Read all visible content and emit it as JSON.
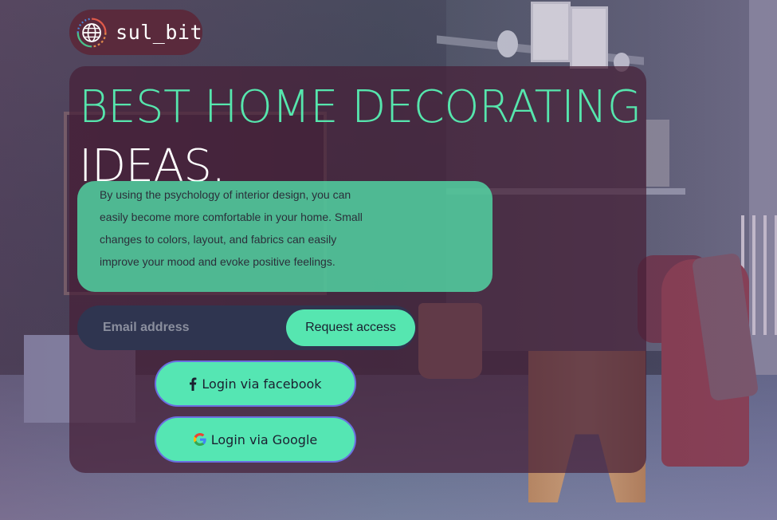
{
  "logo": {
    "text": "sul_bit",
    "icon": "globe-icon"
  },
  "hero": {
    "headline_line1": "BEST HOME DECORATING",
    "headline_line2": "IDEAS.",
    "description": "By using the psychology of interior design, you can easily become more comfortable in your home. Small changes to colors, layout, and fabrics can easily improve your mood and evoke positive feelings."
  },
  "signup": {
    "email_placeholder": "Email address",
    "request_label": "Request access"
  },
  "social": {
    "facebook_label": "Login via facebook",
    "facebook_icon": "facebook-icon",
    "google_label": "Login via Google",
    "google_icon": "google-icon"
  },
  "colors": {
    "accent": "#56e6ad",
    "panel": "#46203a",
    "logo_bg": "#5a2a3c",
    "email_bg": "#2f3550"
  }
}
